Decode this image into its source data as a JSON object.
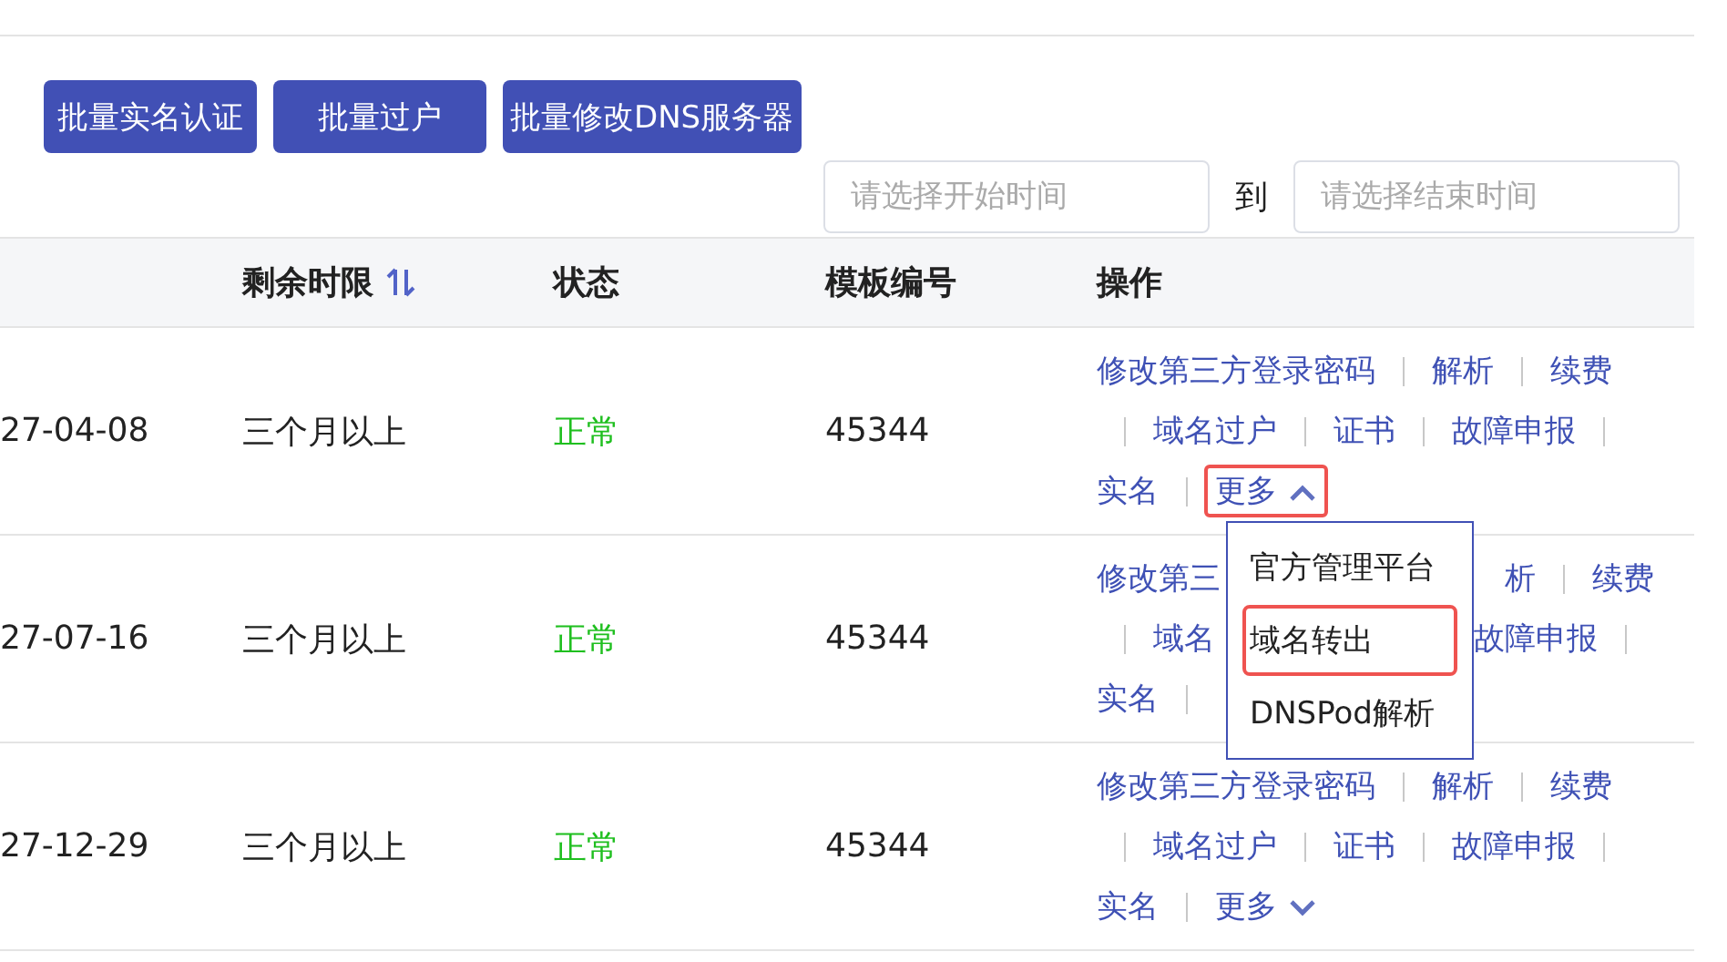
{
  "toolbar": {
    "buttons": [
      "批量实名认证",
      "批量过户",
      "批量修改DNS服务器"
    ]
  },
  "date_range": {
    "start": {
      "placeholder": "请选择开始时间"
    },
    "separator": "到",
    "end": {
      "placeholder": "请选择结束时间"
    }
  },
  "table": {
    "columns": [
      {
        "label": "剩余时限",
        "sortable": true
      },
      {
        "label": "状态",
        "sortable": false
      },
      {
        "label": "模板编号",
        "sortable": false
      },
      {
        "label": "操作",
        "sortable": false
      }
    ],
    "rows": [
      {
        "column_1": "27-04-08",
        "remaining": "三个月以上",
        "status": "正常",
        "template_no": "45344",
        "action_lines": [
          {
            "left": [
              {
                "kind": "link",
                "text": "修改第三方登录密码"
              },
              {
                "kind": "sep"
              },
              {
                "kind": "link",
                "text": "解析"
              },
              {
                "kind": "sep"
              },
              {
                "kind": "link",
                "text": "续费"
              }
            ]
          },
          {
            "left": [
              {
                "kind": "sep"
              },
              {
                "kind": "link",
                "text": "域名过户"
              },
              {
                "kind": "sep"
              },
              {
                "kind": "link",
                "text": "证书"
              },
              {
                "kind": "sep"
              },
              {
                "kind": "link",
                "text": "故障申报"
              },
              {
                "kind": "sep"
              }
            ]
          },
          {
            "left": [
              {
                "kind": "link",
                "text": "实名"
              },
              {
                "kind": "sep"
              },
              {
                "kind": "more",
                "text": "更多",
                "expanded": true,
                "highlighted": true,
                "menu": [
                  {
                    "text": "官方管理平台",
                    "highlighted": false
                  },
                  {
                    "text": "域名转出",
                    "highlighted": true
                  },
                  {
                    "text": "DNSPod解析",
                    "highlighted": false
                  }
                ]
              }
            ]
          }
        ]
      },
      {
        "column_1": "27-07-16",
        "remaining": "三个月以上",
        "status": "正常",
        "template_no": "45344",
        "action_lines": [
          {
            "left": [
              {
                "kind": "link",
                "text": "修改第三"
              }
            ],
            "right": [
              {
                "kind": "link",
                "text": "析"
              },
              {
                "kind": "sep"
              },
              {
                "kind": "link",
                "text": "续费"
              }
            ]
          },
          {
            "left": [
              {
                "kind": "sep"
              },
              {
                "kind": "link",
                "text": "域名"
              }
            ],
            "right": [
              {
                "kind": "link",
                "text": "故障申报"
              },
              {
                "kind": "sep"
              }
            ]
          },
          {
            "left": [
              {
                "kind": "link",
                "text": "实名"
              },
              {
                "kind": "sep"
              }
            ]
          }
        ]
      },
      {
        "column_1": "27-12-29",
        "remaining": "三个月以上",
        "status": "正常",
        "template_no": "45344",
        "action_lines": [
          {
            "left": [
              {
                "kind": "link",
                "text": "修改第三方登录密码"
              },
              {
                "kind": "sep"
              },
              {
                "kind": "link",
                "text": "解析"
              },
              {
                "kind": "sep"
              },
              {
                "kind": "link",
                "text": "续费"
              }
            ]
          },
          {
            "left": [
              {
                "kind": "sep"
              },
              {
                "kind": "link",
                "text": "域名过户"
              },
              {
                "kind": "sep"
              },
              {
                "kind": "link",
                "text": "证书"
              },
              {
                "kind": "sep"
              },
              {
                "kind": "link",
                "text": "故障申报"
              },
              {
                "kind": "sep"
              }
            ]
          },
          {
            "left": [
              {
                "kind": "link",
                "text": "实名"
              },
              {
                "kind": "sep"
              },
              {
                "kind": "more",
                "text": "更多",
                "expanded": false,
                "highlighted": false
              }
            ]
          }
        ]
      }
    ]
  }
}
